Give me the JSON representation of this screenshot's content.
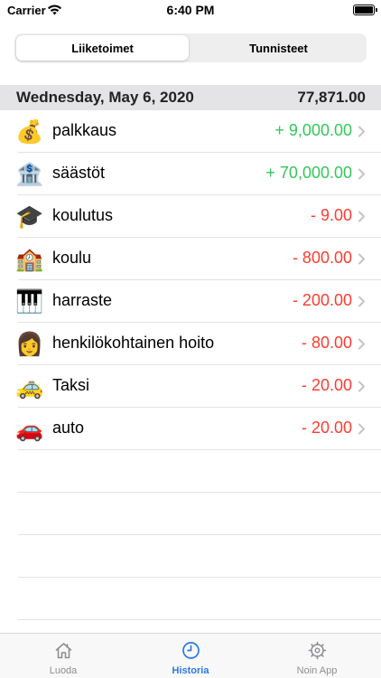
{
  "status_bar": {
    "carrier": "Carrier",
    "time": "6:40 PM"
  },
  "segmented": {
    "selected": "Liiketoimet",
    "other": "Tunnisteet"
  },
  "section": {
    "date": "Wednesday, May 6, 2020",
    "total": "77,871.00"
  },
  "transactions": [
    {
      "emoji": "💰",
      "icon": "money-bag-icon",
      "name": "palkkaus",
      "amount": "+ 9,000.00",
      "type": "pos"
    },
    {
      "emoji": "🏦",
      "icon": "bank-icon",
      "name": "säästöt",
      "amount": "+ 70,000.00",
      "type": "pos"
    },
    {
      "emoji": "🎓",
      "icon": "graduation-cap-icon",
      "name": "koulutus",
      "amount": "- 9.00",
      "type": "neg"
    },
    {
      "emoji": "🏫",
      "icon": "school-icon",
      "name": "koulu",
      "amount": "- 800.00",
      "type": "neg"
    },
    {
      "emoji": "🎹",
      "icon": "piano-icon",
      "name": "harraste",
      "amount": "- 200.00",
      "type": "neg"
    },
    {
      "emoji": "👩",
      "icon": "person-icon",
      "name": "henkilökohtainen hoito",
      "amount": "- 80.00",
      "type": "neg"
    },
    {
      "emoji": "🚕",
      "icon": "taxi-icon",
      "name": "Taksi",
      "amount": "- 20.00",
      "type": "neg"
    },
    {
      "emoji": "🚗",
      "icon": "car-icon",
      "name": "auto",
      "amount": "- 20.00",
      "type": "neg"
    }
  ],
  "tabs": [
    {
      "label": "Luoda",
      "icon": "house-icon",
      "active": false
    },
    {
      "label": "Historia",
      "icon": "clock-icon",
      "active": true
    },
    {
      "label": "Noin App",
      "icon": "gear-icon",
      "active": false
    }
  ],
  "colors": {
    "positive": "#34c759",
    "negative": "#ff3b30",
    "accent": "#2a7ae2",
    "inactive": "#8e8e93"
  }
}
